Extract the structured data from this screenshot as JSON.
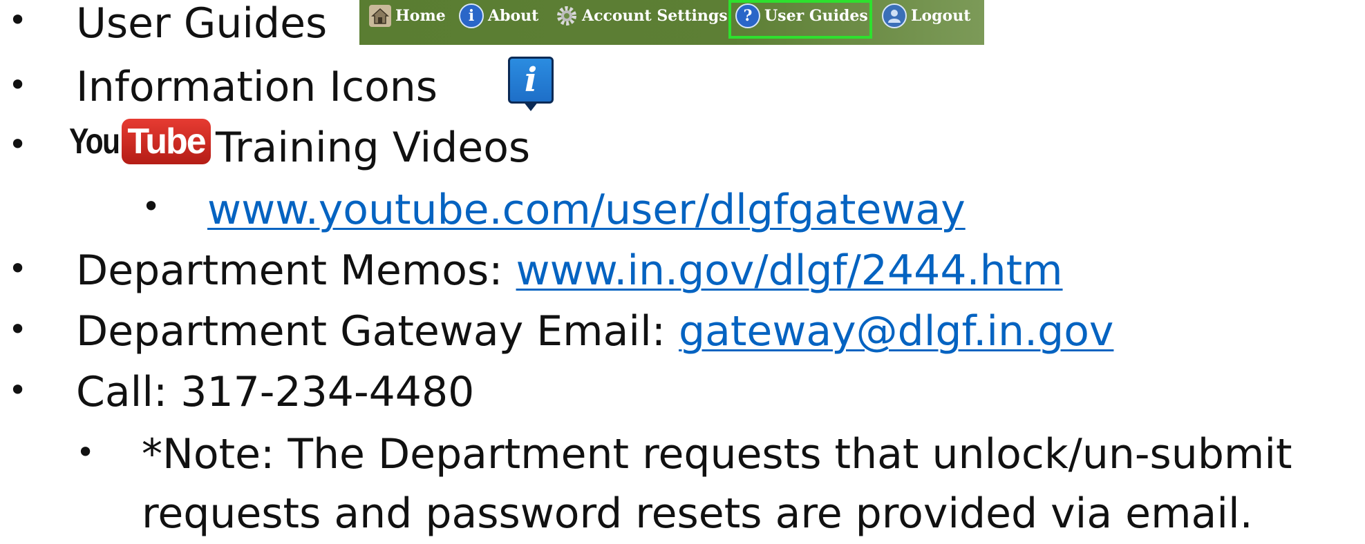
{
  "items": {
    "user_guides": "User Guides",
    "information_icons": "Information Icons",
    "training_videos": "Training Videos",
    "youtube_url": "www.youtube.com/user/dlgfgateway",
    "memos_label": "Department Memos: ",
    "memos_url": "www.in.gov/dlgf/2444.htm",
    "email_label": "Department Gateway Email: ",
    "email_address": "gateway@dlgf.in.gov",
    "call": "Call: 317-234-4480",
    "note_line1": "*Note: The Department requests that unlock/un-submit",
    "note_line2": "requests and password resets are provided via email."
  },
  "bullet": "•",
  "nav": {
    "home": "Home",
    "about": "About",
    "account_settings": "Account Settings",
    "user_guides": "User Guides",
    "logout": "Logout",
    "highlighted": "User Guides"
  },
  "logo": {
    "you": "You",
    "tube": "Tube"
  },
  "info_icon_glyph": "i",
  "colors": {
    "link": "#0563c1",
    "nav_bg": "#5d7f35",
    "highlight": "#2ee02e",
    "youtube_red": "#cc2a22"
  },
  "icons": [
    "home-icon",
    "about-info-icon",
    "gear-icon",
    "help-question-icon",
    "logout-user-icon",
    "information-icon",
    "youtube-logo"
  ]
}
